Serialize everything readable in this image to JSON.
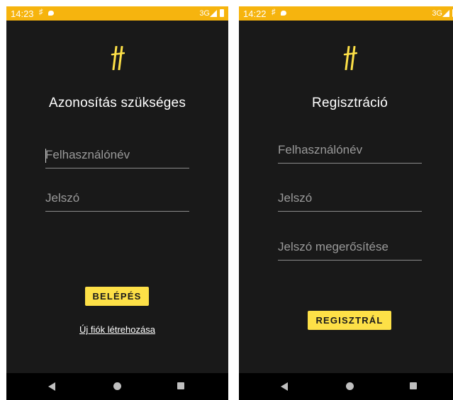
{
  "login_screen": {
    "status_time": "14:23",
    "status_network": "3G",
    "title": "Azonosítás szükséges",
    "username_placeholder": "Felhasználónév",
    "password_placeholder": "Jelszó",
    "login_button": "BELÉPÉS",
    "create_account_link": "Új fiók létrehozása"
  },
  "register_screen": {
    "status_time": "14:22",
    "status_network": "3G",
    "title": "Regisztráció",
    "username_placeholder": "Felhasználónév",
    "password_placeholder": "Jelszó",
    "confirm_password_placeholder": "Jelszó megerősítése",
    "register_button": "REGISZTRÁL"
  },
  "colors": {
    "status_bar": "#f6b40e",
    "background": "#191919",
    "accent_button": "#fde047",
    "logo": "#fde047",
    "nav_bar": "#000000"
  },
  "icons": [
    "app-hash-logo-icon",
    "notification-hash-icon",
    "chat-bubble-icon",
    "signal-icon",
    "battery-icon",
    "back-icon",
    "home-icon",
    "recents-icon"
  ]
}
